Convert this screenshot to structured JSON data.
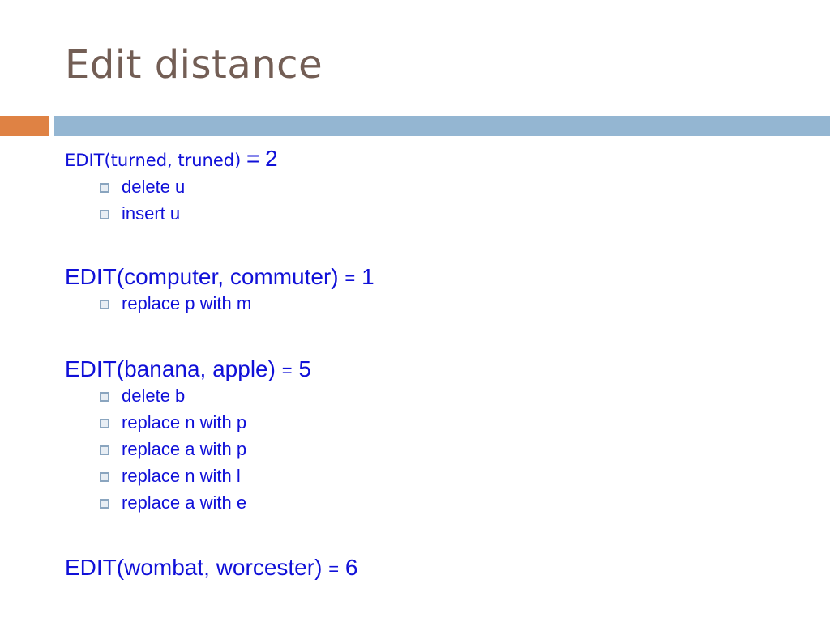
{
  "slide": {
    "title": "Edit distance",
    "accent_colors": {
      "orange": "#df8244",
      "blue": "#94b6d2",
      "title": "#735e55",
      "text": "#1010d8"
    }
  },
  "examples": [
    {
      "label": "EDIT(turned, truned)",
      "eq": "=",
      "value": "2",
      "steps": [
        "delete u",
        "insert u"
      ]
    },
    {
      "label": "EDIT(computer, commuter)",
      "eq": "=",
      "value": "1",
      "steps": [
        "replace p with m"
      ]
    },
    {
      "label": "EDIT(banana, apple)",
      "eq": "=",
      "value": "5",
      "steps": [
        "delete b",
        "replace n with p",
        "replace a with p",
        "replace n with l",
        "replace a with e"
      ]
    },
    {
      "label": "EDIT(wombat, worcester)",
      "eq": "=",
      "value": "6",
      "steps": []
    }
  ]
}
